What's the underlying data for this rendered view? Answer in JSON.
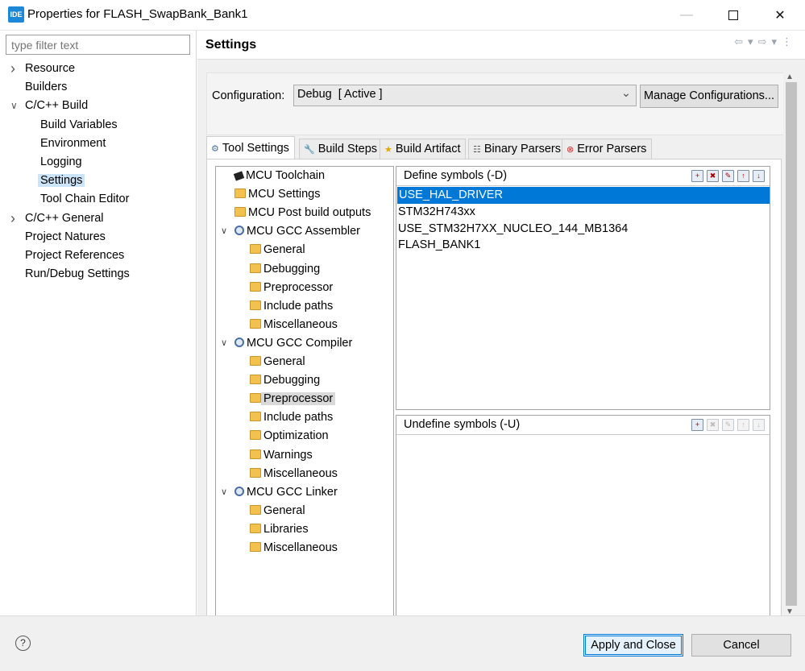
{
  "window": {
    "title": "Properties for FLASH_SwapBank_Bank1",
    "icon_text": "IDE"
  },
  "left": {
    "filter_placeholder": "type filter text",
    "items": [
      {
        "label": "Resource",
        "expandable": true,
        "expanded": false
      },
      {
        "label": "Builders"
      },
      {
        "label": "C/C++ Build",
        "expandable": true,
        "expanded": true
      },
      {
        "label": "Build Variables"
      },
      {
        "label": "Environment"
      },
      {
        "label": "Logging"
      },
      {
        "label": "Settings",
        "selected": true
      },
      {
        "label": "Tool Chain Editor"
      },
      {
        "label": "C/C++ General",
        "expandable": true,
        "expanded": false
      },
      {
        "label": "Project Natures"
      },
      {
        "label": "Project References"
      },
      {
        "label": "Run/Debug Settings"
      }
    ]
  },
  "right": {
    "title": "Settings",
    "config_label": "Configuration:",
    "config_value": "Debug  [ Active ]",
    "manage_label": "Manage Configurations...",
    "tabs": [
      {
        "label": "Tool Settings",
        "active": true,
        "icon": "gear-icon"
      },
      {
        "label": "Build Steps",
        "icon": "wrench-icon"
      },
      {
        "label": "Build Artifact",
        "icon": "trophy-icon"
      },
      {
        "label": "Binary Parsers",
        "icon": "document-icon"
      },
      {
        "label": "Error Parsers",
        "icon": "error-icon"
      }
    ],
    "tree": [
      {
        "label": "MCU Toolchain",
        "icon": "chip-icon"
      },
      {
        "label": "MCU Settings",
        "icon": "folder-icon"
      },
      {
        "label": "MCU Post build outputs",
        "icon": "folder-icon"
      },
      {
        "label": "MCU GCC Assembler",
        "icon": "gear-icon",
        "expandable": true
      },
      {
        "label": "General",
        "icon": "folder-icon",
        "child": true
      },
      {
        "label": "Debugging",
        "icon": "folder-icon",
        "child": true
      },
      {
        "label": "Preprocessor",
        "icon": "folder-icon",
        "child": true
      },
      {
        "label": "Include paths",
        "icon": "folder-icon",
        "child": true
      },
      {
        "label": "Miscellaneous",
        "icon": "folder-icon",
        "child": true
      },
      {
        "label": "MCU GCC Compiler",
        "icon": "gear-icon",
        "expandable": true
      },
      {
        "label": "General",
        "icon": "folder-icon",
        "child": true
      },
      {
        "label": "Debugging",
        "icon": "folder-icon",
        "child": true
      },
      {
        "label": "Preprocessor",
        "icon": "folder-icon",
        "child": true,
        "selected": true
      },
      {
        "label": "Include paths",
        "icon": "folder-icon",
        "child": true
      },
      {
        "label": "Optimization",
        "icon": "folder-icon",
        "child": true
      },
      {
        "label": "Warnings",
        "icon": "folder-icon",
        "child": true
      },
      {
        "label": "Miscellaneous",
        "icon": "folder-icon",
        "child": true
      },
      {
        "label": "MCU GCC Linker",
        "icon": "gear-icon",
        "expandable": true
      },
      {
        "label": "General",
        "icon": "folder-icon",
        "child": true
      },
      {
        "label": "Libraries",
        "icon": "folder-icon",
        "child": true
      },
      {
        "label": "Miscellaneous",
        "icon": "folder-icon",
        "child": true
      }
    ],
    "define": {
      "title": "Define symbols (-D)",
      "symbols": [
        "USE_HAL_DRIVER",
        "STM32H743xx",
        "USE_STM32H7XX_NUCLEO_144_MB1364",
        "FLASH_BANK1"
      ],
      "selected_index": 0
    },
    "undefine": {
      "title": "Undefine symbols (-U)",
      "symbols": []
    }
  },
  "bottom": {
    "apply_label": "Apply and Close",
    "cancel_label": "Cancel",
    "help_glyph": "?"
  },
  "colors": {
    "selection": "#0078d7",
    "nav_selected": "#cce4f7"
  }
}
